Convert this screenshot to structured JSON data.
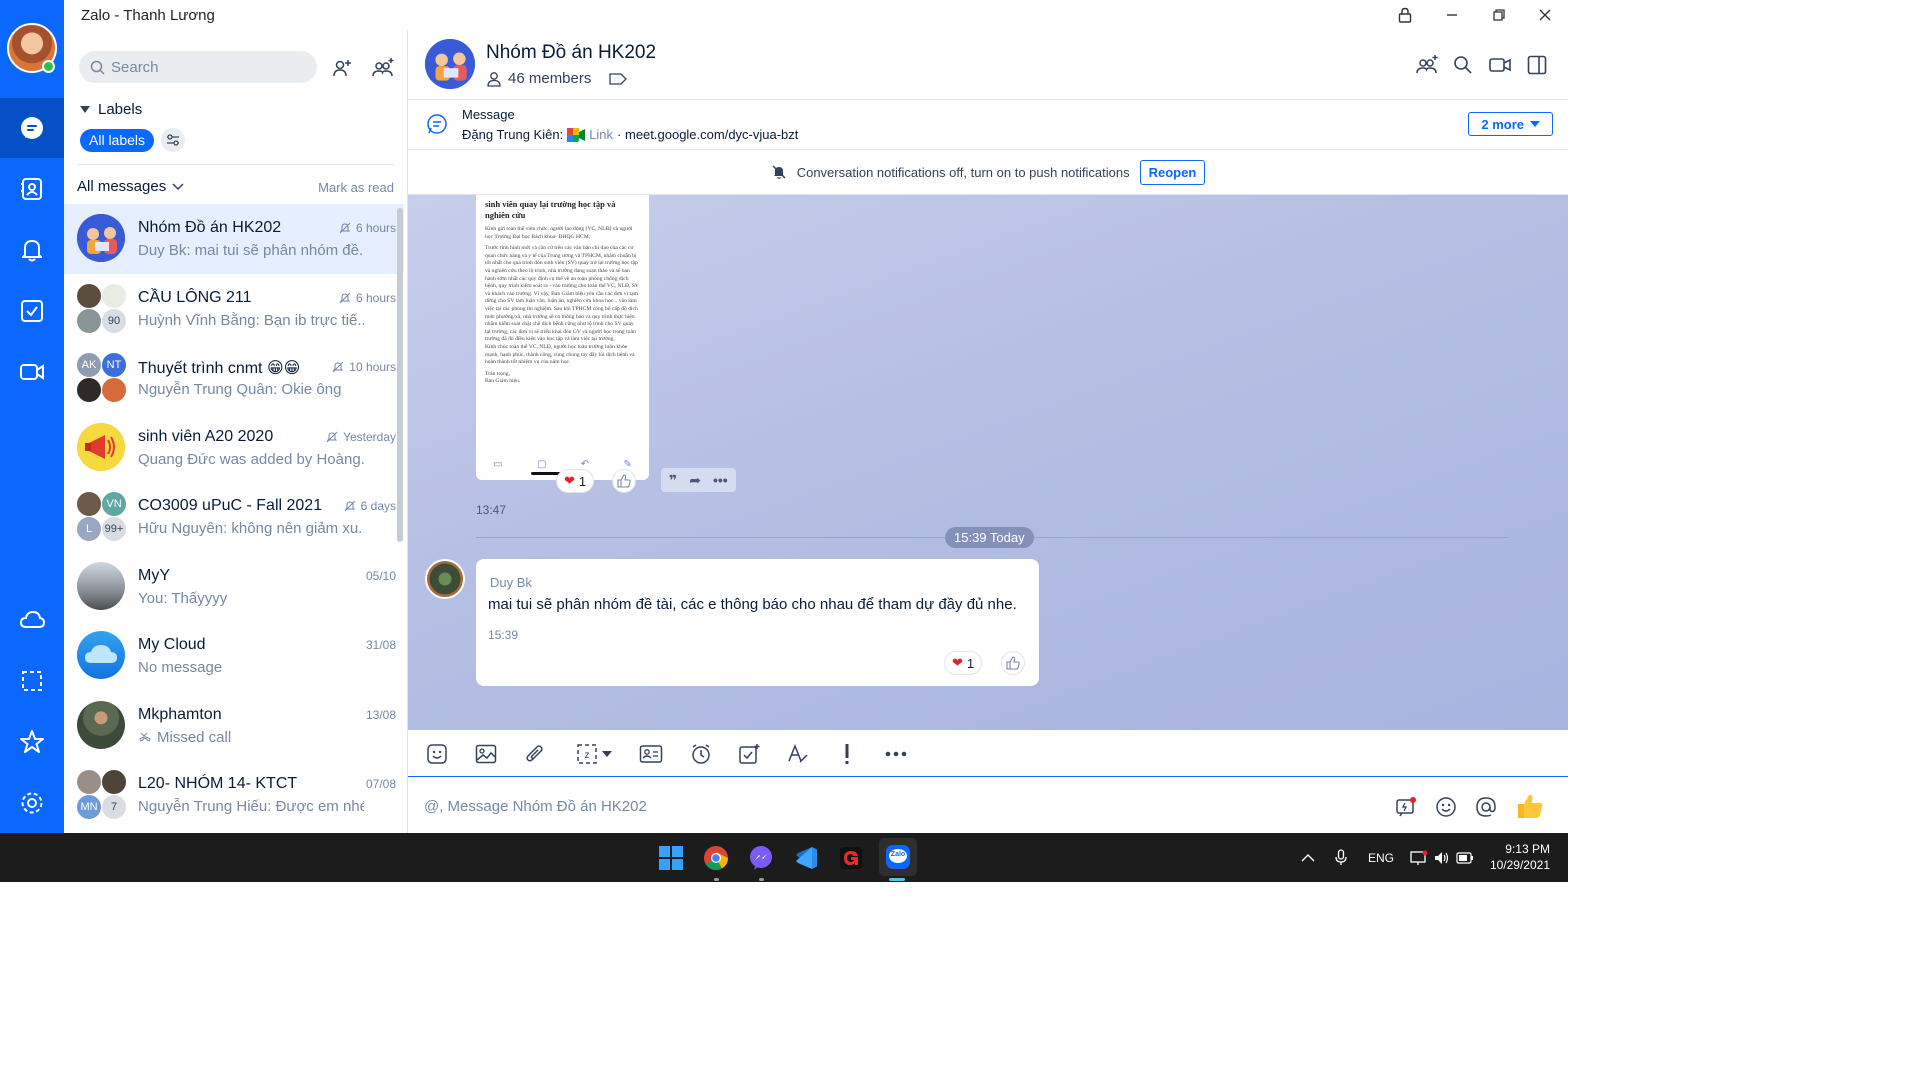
{
  "window": {
    "title": "Zalo - Thanh Lương"
  },
  "sidebar": {
    "search_placeholder": "Search",
    "labels_title": "Labels",
    "all_labels_chip": "All labels",
    "all_messages": "All messages",
    "mark_as_read": "Mark as read",
    "conversations": [
      {
        "name": "Nhóm Đồ án HK202",
        "preview": "Duy Bk: mai tui sẽ phân nhóm đề...",
        "time": "6 hours",
        "muted": true
      },
      {
        "name": "CẦU LÔNG 211",
        "preview": "Huỳnh Vĩnh Bằng: Bạn ib trực tiế...",
        "time": "6 hours",
        "muted": true,
        "badge": "90"
      },
      {
        "name": "Thuyết trình cnmt 😁😁",
        "preview": "Nguyễn Trung Quân: Okie ông",
        "time": "10 hours",
        "muted": true,
        "mini": [
          "AK",
          "NT"
        ]
      },
      {
        "name": "sinh viên A20 2020",
        "preview": "Quang Đức was added by Hoàng...",
        "time": "Yesterday",
        "muted": true
      },
      {
        "name": "CO3009 uPuC - Fall 2021",
        "preview": "Hữu Nguyên: không nên giảm xu...",
        "time": "6 days",
        "muted": true,
        "mini": [
          "VN",
          "L",
          "99+"
        ]
      },
      {
        "name": "MyY",
        "preview": "You: Thấyyyy",
        "time": "05/10"
      },
      {
        "name": "My Cloud",
        "preview": "No message",
        "time": "31/08"
      },
      {
        "name": "Mkphamton",
        "preview": "Missed call",
        "time": "13/08"
      },
      {
        "name": "L20- NHÓM 14- KTCT",
        "preview": "Nguyễn Trung Hiếu: Được em nhé",
        "time": "07/08",
        "mini": [
          "MN",
          "7"
        ]
      }
    ]
  },
  "chat": {
    "group_name": "Nhóm Đồ án HK202",
    "members": "46 members",
    "pinned": {
      "label": "Message",
      "sender": "Đặng Trung Kiên:",
      "link_label": "Link",
      "link_url": "· meet.google.com/dyc-vjua-bzt",
      "more": "2 more"
    },
    "notification": {
      "text": "Conversation notifications off, turn on to push notifications",
      "button": "Reopen"
    },
    "doc_preview": {
      "heading": "sinh viên quay lại trường học tập và nghiên cứu",
      "body1": "Kính gửi toàn thể viên chức, người lao động (VC, NLĐ) và người học Trường Đại học Bách khoa- ĐHQG HCM;",
      "body2": "Trước tình hình mới và căn cứ trên các văn bản chỉ đạo của các cơ quan chức năng và y tế của Trung ương và TPHCM, nhằm chuẩn bị tốt nhất cho quá trình đón sinh viên (SV) quay trở lại trường học tập và nghiên cứu theo lộ trình, nhà trường đang soạn thảo và sẽ ban hành sớm nhất các quy định cụ thể về an toàn phòng chống dịch bệnh, quy trình kiểm soát ra - vào trường cho toàn thể VC, NLĐ, SV và khách vào trường. Vì vậy, Ban Giám hiệu yêu cầu các đơn vị tạm dừng cho SV làm luận văn, luận án, nghiên cứu khoa học... vào làm việc tại các phòng thí nghiệm. Sau khi TPHCM công bố cấp độ dịch mức phường/xã, nhà trường sẽ có thông báo và quy trình thực hiện nhằm kiểm soát chặt chẽ dịch bệnh cũng như lộ trình cho SV quay lại trường, các đơn vị sẽ triển khai đón GV và người học trong toàn trường đã đủ điều kiện vào học tập và làm việc tại trường.",
      "body3": "Kính chúc toàn thể VC, NLĐ, người học toàn trường luôn khỏe mạnh, hạnh phúc, thành công, cùng chung tay đẩy lùi dịch bệnh và hoàn thành tốt nhiệm vụ của năm học.",
      "sign1": "Trân trọng,",
      "sign2": "Ban Giám hiệu."
    },
    "doc_reaction_count": "1",
    "doc_time": "13:47",
    "separator": "15:39 Today",
    "message": {
      "sender": "Duy Bk",
      "text": "mai tui sẽ phân nhóm đề tài, các e thông báo cho nhau để tham dự đầy đủ nhe.",
      "time": "15:39",
      "reaction_count": "1"
    },
    "composer_placeholder": "@, Message Nhóm Đồ án HK202"
  },
  "taskbar": {
    "lang": "ENG",
    "time": "9:13 PM",
    "date": "10/29/2021",
    "zalo_label": "Zalo"
  },
  "colors": {
    "brand": "#0a68fe",
    "nav_active": "#0550c6",
    "chat_bg": "#b6c0e4"
  }
}
